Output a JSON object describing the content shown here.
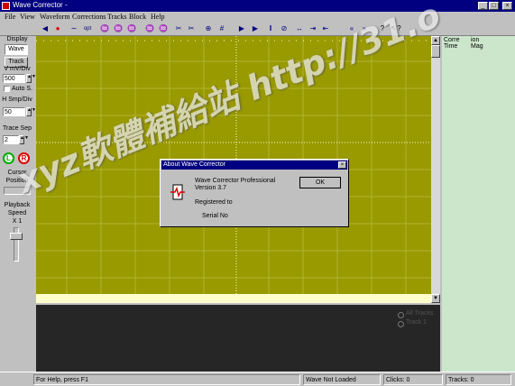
{
  "window": {
    "title": "Wave Corrector -"
  },
  "menu": [
    "File",
    "View",
    "Waveform",
    "Corrections",
    "Tracks",
    "Block",
    "Help"
  ],
  "toolbar_icons": [
    "play-reverse-icon",
    "record-icon",
    "clear-icon",
    "opt-icon",
    "wave-tool-icon",
    "wave-tool-icon",
    "wave-tool-icon",
    "wave-tool-icon",
    "wave-tool-icon",
    "cut-icon",
    "cut-icon",
    "zoom-icon",
    "zoom-icon",
    "grid-icon",
    "play-icon",
    "play-icon",
    "pause-icon",
    "stop-icon",
    "marker-icon",
    "marker-icon",
    "marker-icon",
    "rewind-icon",
    "forward-icon",
    "help-icon",
    "context-help-icon"
  ],
  "left": {
    "display_label": "Display",
    "wave_button": "Wave",
    "track_button": "Track",
    "v_label": "V mV/Div",
    "v_value": "500",
    "auto_scale": "Auto S.",
    "h_label": "H Smp/Div",
    "h_value": "50",
    "trace_sep_label": "Trace Sep",
    "trace_sep_value": "2",
    "l_label": "L",
    "r_label": "R",
    "cursor_label": "Cursor",
    "position_label": "Position",
    "playback_label": "Playback",
    "speed_label": "Speed",
    "speed_value": "X 1"
  },
  "right": {
    "col1": "Corre",
    "col1b": "Time",
    "col2": "ion",
    "col2b": "Mag"
  },
  "track_options": {
    "all_tracks": "All Tracks",
    "track_1": "Track 1"
  },
  "dialog": {
    "title": "About Wave Corrector",
    "product": "Wave Corrector Professional",
    "version": "Version 3.7",
    "registered": "Registered to",
    "serial": "Serial No",
    "ok": "OK"
  },
  "status": {
    "help": "For Help, press F1",
    "wave": "Wave Not Loaded",
    "clicks": "Clicks: 0",
    "tracks": "Tracks: 0"
  },
  "watermark": "xyz軟體補給站 http://31.o",
  "colors": {
    "scope": "#999900",
    "right_panel": "#cce6cc",
    "title": "#000080",
    "dark_panel": "#262626"
  }
}
